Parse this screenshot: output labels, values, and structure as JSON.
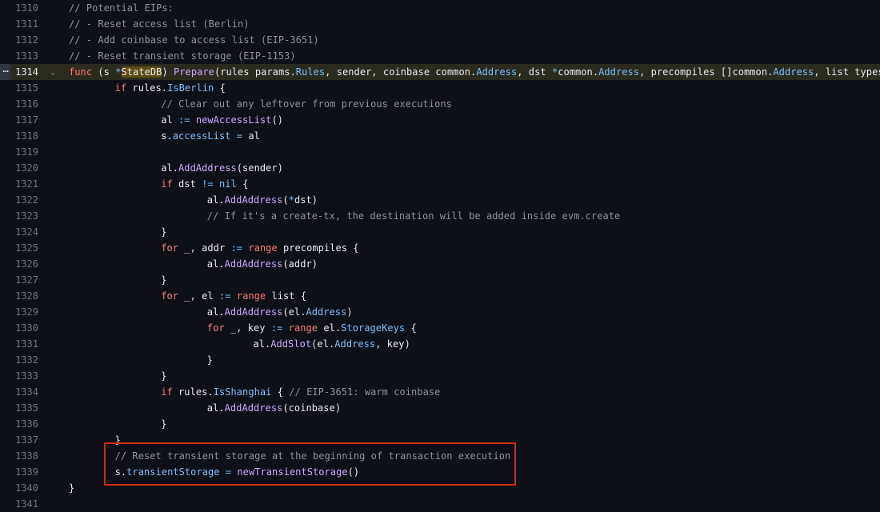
{
  "editor": {
    "active_line": 1314,
    "annotation_color": "#d0281c",
    "line_options_icon": "kebab-horizontal-icon",
    "fold_icon": "chevron-down-icon",
    "lines": [
      {
        "n": "1310",
        "indent": 0,
        "segs": [
          [
            "c",
            "// Potential EIPs:"
          ]
        ]
      },
      {
        "n": "1311",
        "indent": 0,
        "segs": [
          [
            "c",
            "// - Reset access list (Berlin)"
          ]
        ]
      },
      {
        "n": "1312",
        "indent": 0,
        "segs": [
          [
            "c",
            "// - Add coinbase to access list (EIP-3651)"
          ]
        ]
      },
      {
        "n": "1313",
        "indent": 0,
        "segs": [
          [
            "c",
            "// - Reset transient storage (EIP-1153)"
          ]
        ]
      },
      {
        "n": "1314",
        "indent": 0,
        "segs": [
          [
            "k",
            "func"
          ],
          [
            "p",
            " (s "
          ],
          [
            "o",
            "*"
          ],
          [
            "hl",
            "StateDB"
          ],
          [
            "p",
            ") "
          ],
          [
            "f",
            "Prepare"
          ],
          [
            "p",
            "(rules params."
          ],
          [
            "pr",
            "Rules"
          ],
          [
            "p",
            ", sender, coinbase common."
          ],
          [
            "pr",
            "Address"
          ],
          [
            "p",
            ", dst "
          ],
          [
            "o",
            "*"
          ],
          [
            "p",
            "common."
          ],
          [
            "pr",
            "Address"
          ],
          [
            "p",
            ", precompiles []common."
          ],
          [
            "pr",
            "Address"
          ],
          [
            "p",
            ", list types."
          ]
        ]
      },
      {
        "n": "1315",
        "indent": 1,
        "segs": [
          [
            "k",
            "if"
          ],
          [
            "p",
            " rules."
          ],
          [
            "pr",
            "IsBerlin"
          ],
          [
            "p",
            " {"
          ]
        ]
      },
      {
        "n": "1316",
        "indent": 2,
        "segs": [
          [
            "c",
            "// Clear out any leftover from previous executions"
          ]
        ]
      },
      {
        "n": "1317",
        "indent": 2,
        "segs": [
          [
            "p",
            "al "
          ],
          [
            "o",
            ":="
          ],
          [
            "p",
            " "
          ],
          [
            "f",
            "newAccessList"
          ],
          [
            "p",
            "()"
          ]
        ]
      },
      {
        "n": "1318",
        "indent": 2,
        "segs": [
          [
            "p",
            "s."
          ],
          [
            "pr",
            "accessList"
          ],
          [
            "p",
            " "
          ],
          [
            "o",
            "="
          ],
          [
            "p",
            " al"
          ]
        ]
      },
      {
        "n": "1319",
        "indent": 0,
        "segs": []
      },
      {
        "n": "1320",
        "indent": 2,
        "segs": [
          [
            "p",
            "al."
          ],
          [
            "f",
            "AddAddress"
          ],
          [
            "p",
            "(sender)"
          ]
        ]
      },
      {
        "n": "1321",
        "indent": 2,
        "segs": [
          [
            "k",
            "if"
          ],
          [
            "p",
            " dst "
          ],
          [
            "o",
            "!="
          ],
          [
            "p",
            " "
          ],
          [
            "pr",
            "nil"
          ],
          [
            "p",
            " {"
          ]
        ]
      },
      {
        "n": "1322",
        "indent": 3,
        "segs": [
          [
            "p",
            "al."
          ],
          [
            "f",
            "AddAddress"
          ],
          [
            "p",
            "("
          ],
          [
            "o",
            "*"
          ],
          [
            "p",
            "dst)"
          ]
        ]
      },
      {
        "n": "1323",
        "indent": 3,
        "segs": [
          [
            "c",
            "// If it's a create-tx, the destination will be added inside evm.create"
          ]
        ]
      },
      {
        "n": "1324",
        "indent": 2,
        "segs": [
          [
            "p",
            "}"
          ]
        ]
      },
      {
        "n": "1325",
        "indent": 2,
        "segs": [
          [
            "k",
            "for"
          ],
          [
            "p",
            " _, addr "
          ],
          [
            "o",
            ":="
          ],
          [
            "p",
            " "
          ],
          [
            "k",
            "range"
          ],
          [
            "p",
            " precompiles {"
          ]
        ]
      },
      {
        "n": "1326",
        "indent": 3,
        "segs": [
          [
            "p",
            "al."
          ],
          [
            "f",
            "AddAddress"
          ],
          [
            "p",
            "(addr)"
          ]
        ]
      },
      {
        "n": "1327",
        "indent": 2,
        "segs": [
          [
            "p",
            "}"
          ]
        ]
      },
      {
        "n": "1328",
        "indent": 2,
        "segs": [
          [
            "k",
            "for"
          ],
          [
            "p",
            " _, el "
          ],
          [
            "o",
            ":="
          ],
          [
            "p",
            " "
          ],
          [
            "k",
            "range"
          ],
          [
            "p",
            " list {"
          ]
        ]
      },
      {
        "n": "1329",
        "indent": 3,
        "segs": [
          [
            "p",
            "al."
          ],
          [
            "f",
            "AddAddress"
          ],
          [
            "p",
            "(el."
          ],
          [
            "pr",
            "Address"
          ],
          [
            "p",
            ")"
          ]
        ]
      },
      {
        "n": "1330",
        "indent": 3,
        "segs": [
          [
            "k",
            "for"
          ],
          [
            "p",
            " _, key "
          ],
          [
            "o",
            ":="
          ],
          [
            "p",
            " "
          ],
          [
            "k",
            "range"
          ],
          [
            "p",
            " el."
          ],
          [
            "pr",
            "StorageKeys"
          ],
          [
            "p",
            " {"
          ]
        ]
      },
      {
        "n": "1331",
        "indent": 4,
        "segs": [
          [
            "p",
            "al."
          ],
          [
            "f",
            "AddSlot"
          ],
          [
            "p",
            "(el."
          ],
          [
            "pr",
            "Address"
          ],
          [
            "p",
            ", key)"
          ]
        ]
      },
      {
        "n": "1332",
        "indent": 3,
        "segs": [
          [
            "p",
            "}"
          ]
        ]
      },
      {
        "n": "1333",
        "indent": 2,
        "segs": [
          [
            "p",
            "}"
          ]
        ]
      },
      {
        "n": "1334",
        "indent": 2,
        "segs": [
          [
            "k",
            "if"
          ],
          [
            "p",
            " rules."
          ],
          [
            "pr",
            "IsShanghai"
          ],
          [
            "p",
            " { "
          ],
          [
            "c",
            "// EIP-3651: warm coinbase"
          ]
        ]
      },
      {
        "n": "1335",
        "indent": 3,
        "segs": [
          [
            "p",
            "al."
          ],
          [
            "f",
            "AddAddress"
          ],
          [
            "p",
            "(coinbase)"
          ]
        ]
      },
      {
        "n": "1336",
        "indent": 2,
        "segs": [
          [
            "p",
            "}"
          ]
        ]
      },
      {
        "n": "1337",
        "indent": 1,
        "segs": [
          [
            "p",
            "}"
          ]
        ]
      },
      {
        "n": "1338",
        "indent": 1,
        "segs": [
          [
            "c",
            "// Reset transient storage at the beginning of transaction execution"
          ]
        ]
      },
      {
        "n": "1339",
        "indent": 1,
        "segs": [
          [
            "p",
            "s."
          ],
          [
            "pr",
            "transientStorage"
          ],
          [
            "p",
            " "
          ],
          [
            "o",
            "="
          ],
          [
            "p",
            " "
          ],
          [
            "f",
            "newTransientStorage"
          ],
          [
            "p",
            "()"
          ]
        ]
      },
      {
        "n": "1340",
        "indent": 0,
        "segs": [
          [
            "p",
            "}"
          ]
        ]
      },
      {
        "n": "1341",
        "indent": 0,
        "segs": []
      }
    ]
  }
}
